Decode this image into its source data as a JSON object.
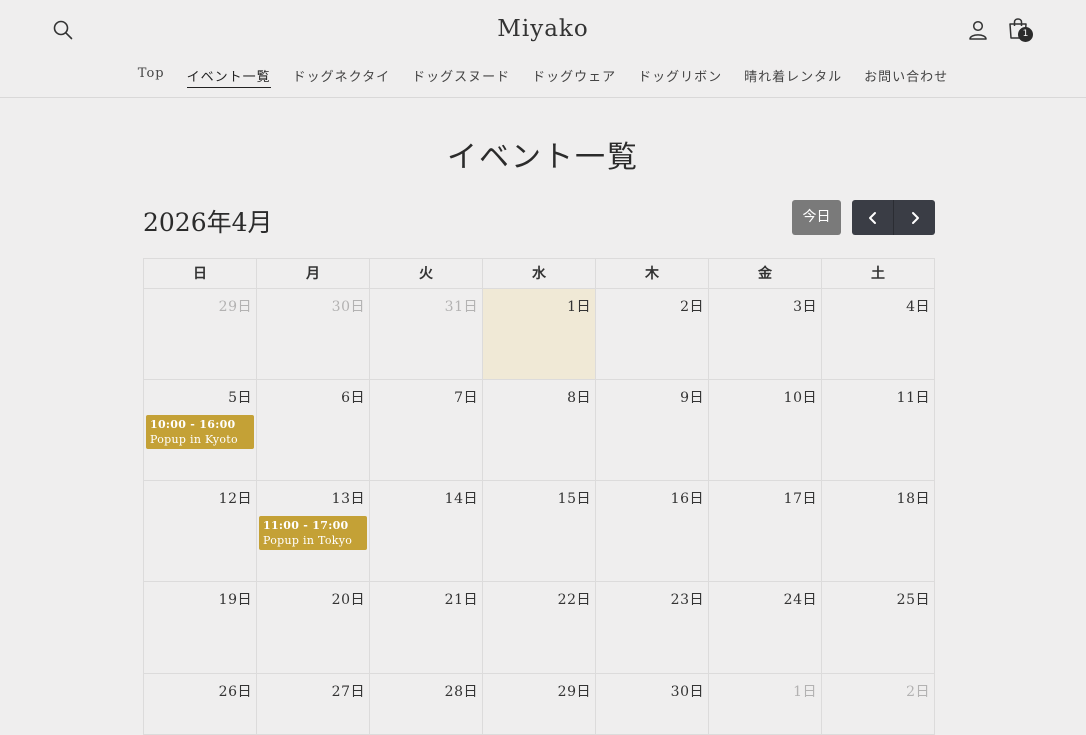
{
  "header": {
    "logo": "Miyako",
    "cart_count": "1"
  },
  "nav": [
    {
      "label": "Top",
      "active": false
    },
    {
      "label": "イベント一覧",
      "active": true
    },
    {
      "label": "ドッグネクタイ",
      "active": false
    },
    {
      "label": "ドッグスヌード",
      "active": false
    },
    {
      "label": "ドッグウェア",
      "active": false
    },
    {
      "label": "ドッグリボン",
      "active": false
    },
    {
      "label": "晴れ着レンタル",
      "active": false
    },
    {
      "label": "お問い合わせ",
      "active": false
    }
  ],
  "page": {
    "title": "イベント一覧",
    "month": "2026年4月",
    "today_label": "今日"
  },
  "calendar": {
    "weekdays": [
      "日",
      "月",
      "火",
      "水",
      "木",
      "金",
      "土"
    ],
    "weeks": [
      [
        {
          "label": "29日",
          "other": true
        },
        {
          "label": "30日",
          "other": true
        },
        {
          "label": "31日",
          "other": true
        },
        {
          "label": "1日",
          "today": true
        },
        {
          "label": "2日"
        },
        {
          "label": "3日"
        },
        {
          "label": "4日"
        }
      ],
      [
        {
          "label": "5日",
          "event": {
            "time": "10:00 - 16:00",
            "title": "Popup in Kyoto"
          }
        },
        {
          "label": "6日"
        },
        {
          "label": "7日"
        },
        {
          "label": "8日"
        },
        {
          "label": "9日"
        },
        {
          "label": "10日"
        },
        {
          "label": "11日"
        }
      ],
      [
        {
          "label": "12日"
        },
        {
          "label": "13日",
          "event": {
            "time": "11:00 - 17:00",
            "title": "Popup in Tokyo"
          }
        },
        {
          "label": "14日"
        },
        {
          "label": "15日"
        },
        {
          "label": "16日"
        },
        {
          "label": "17日"
        },
        {
          "label": "18日"
        }
      ],
      [
        {
          "label": "19日"
        },
        {
          "label": "20日"
        },
        {
          "label": "21日"
        },
        {
          "label": "22日"
        },
        {
          "label": "23日"
        },
        {
          "label": "24日"
        },
        {
          "label": "25日"
        }
      ],
      [
        {
          "label": "26日"
        },
        {
          "label": "27日"
        },
        {
          "label": "28日"
        },
        {
          "label": "29日"
        },
        {
          "label": "30日"
        },
        {
          "label": "1日",
          "other": true
        },
        {
          "label": "2日",
          "other": true
        }
      ]
    ]
  },
  "colors": {
    "event": "#c4a136",
    "today_bg": "#f0e9d6",
    "nav_buttons": "#3a3d45"
  }
}
